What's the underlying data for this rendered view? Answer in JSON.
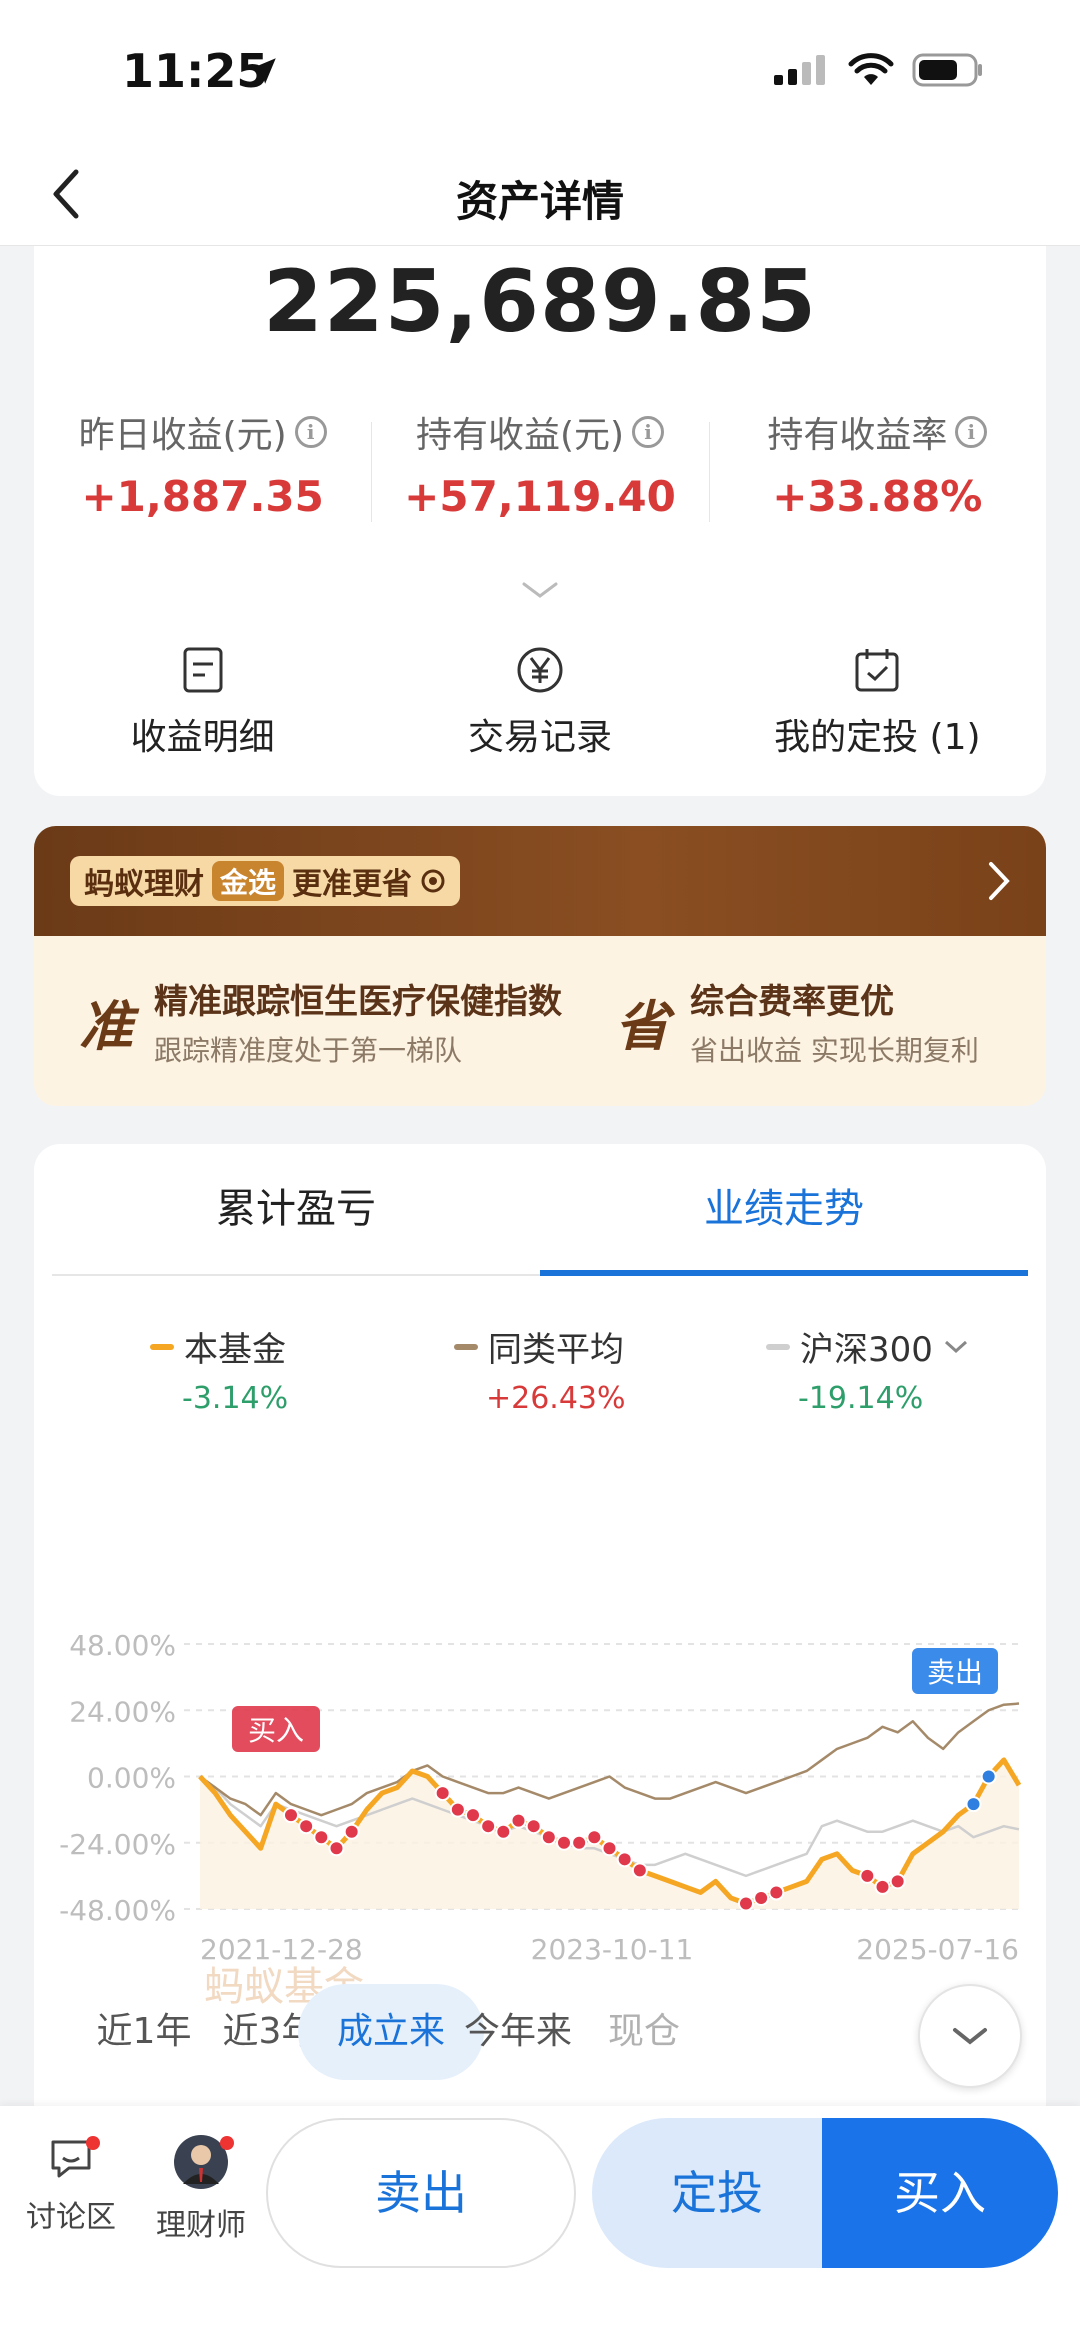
{
  "status_bar": {
    "time": "11:25"
  },
  "nav": {
    "title": "资产详情"
  },
  "asset": {
    "total": "225,689.85",
    "stats": [
      {
        "label": "昨日收益(元)",
        "value": "+1,887.35"
      },
      {
        "label": "持有收益(元)",
        "value": "+57,119.40"
      },
      {
        "label": "持有收益率",
        "value": "+33.88%"
      }
    ],
    "actions": [
      {
        "label": "收益明细",
        "icon": "document-icon"
      },
      {
        "label": "交易记录",
        "icon": "yen-circle-icon"
      },
      {
        "label": "我的定投 (1)",
        "icon": "calendar-check-icon"
      }
    ]
  },
  "promo": {
    "brand": "蚂蚁理财",
    "badge": "金选",
    "slogan": "更准更省",
    "items": [
      {
        "char": "准",
        "title": "精准跟踪恒生医疗保健指数",
        "sub": "跟踪精准度处于第一梯队"
      },
      {
        "char": "省",
        "title": "综合费率更优",
        "sub": "省出收益 实现长期复利"
      }
    ]
  },
  "perf": {
    "tabs": [
      "累计盈亏",
      "业绩走势"
    ],
    "active_tab": 1,
    "legend": [
      {
        "name": "本基金",
        "pct": "-3.14%",
        "color": "#f5a623",
        "pct_color": "#2e9e6b"
      },
      {
        "name": "同类平均",
        "pct": "+26.43%",
        "color": "#a58a6a",
        "pct_color": "#d83a3a"
      },
      {
        "name": "沪深300",
        "pct": "-19.14%",
        "color": "#cfcfcf",
        "pct_color": "#2e9e6b"
      }
    ],
    "watermark": "蚂蚁基金",
    "buy_marker": "买入",
    "sell_marker": "卖出",
    "periods": [
      "近1年",
      "近3年",
      "成立来",
      "今年来",
      "现仓"
    ],
    "active_period": 2
  },
  "chart_data": {
    "type": "line",
    "ylim": [
      -48,
      48
    ],
    "y_ticks": [
      "48.00%",
      "24.00%",
      "0.00%",
      "-24.00%",
      "-48.00%"
    ],
    "x_ticks": [
      "2021-12-28",
      "2023-10-11",
      "2025-07-16"
    ],
    "series": [
      {
        "name": "本基金",
        "values": [
          0,
          -6,
          -14,
          -20,
          -26,
          -10,
          -14,
          -18,
          -22,
          -26,
          -20,
          -12,
          -6,
          -4,
          2,
          0,
          -6,
          -12,
          -14,
          -18,
          -20,
          -16,
          -18,
          -22,
          -24,
          -24,
          -22,
          -26,
          -30,
          -34,
          -36,
          -38,
          -40,
          -42,
          -38,
          -44,
          -46,
          -44,
          -42,
          -40,
          -38,
          -30,
          -28,
          -34,
          -36,
          -40,
          -38,
          -28,
          -24,
          -20,
          -14,
          -10,
          0,
          6,
          -3.14
        ]
      },
      {
        "name": "同类平均",
        "values": [
          0,
          -4,
          -8,
          -10,
          -14,
          -6,
          -10,
          -12,
          -14,
          -12,
          -10,
          -6,
          -4,
          -2,
          2,
          4,
          0,
          -2,
          -4,
          -6,
          -6,
          -4,
          -6,
          -8,
          -6,
          -4,
          -2,
          0,
          -4,
          -6,
          -8,
          -8,
          -6,
          -4,
          -2,
          -4,
          -6,
          -4,
          -2,
          0,
          2,
          6,
          10,
          12,
          14,
          18,
          16,
          20,
          14,
          10,
          16,
          20,
          24,
          26,
          26.43
        ]
      },
      {
        "name": "沪深300",
        "values": [
          0,
          -4,
          -10,
          -14,
          -18,
          -10,
          -12,
          -14,
          -16,
          -18,
          -16,
          -14,
          -12,
          -10,
          -8,
          -10,
          -12,
          -14,
          -16,
          -18,
          -20,
          -18,
          -20,
          -22,
          -24,
          -26,
          -26,
          -28,
          -30,
          -32,
          -32,
          -30,
          -28,
          -30,
          -32,
          -34,
          -36,
          -34,
          -32,
          -30,
          -28,
          -18,
          -16,
          -18,
          -20,
          -20,
          -18,
          -16,
          -18,
          -20,
          -18,
          -22,
          -20,
          -18,
          -19.14
        ]
      }
    ]
  },
  "bottom": {
    "discuss": "讨论区",
    "advisor": "理财师",
    "sell": "卖出",
    "sip": "定投",
    "buy": "买入"
  }
}
